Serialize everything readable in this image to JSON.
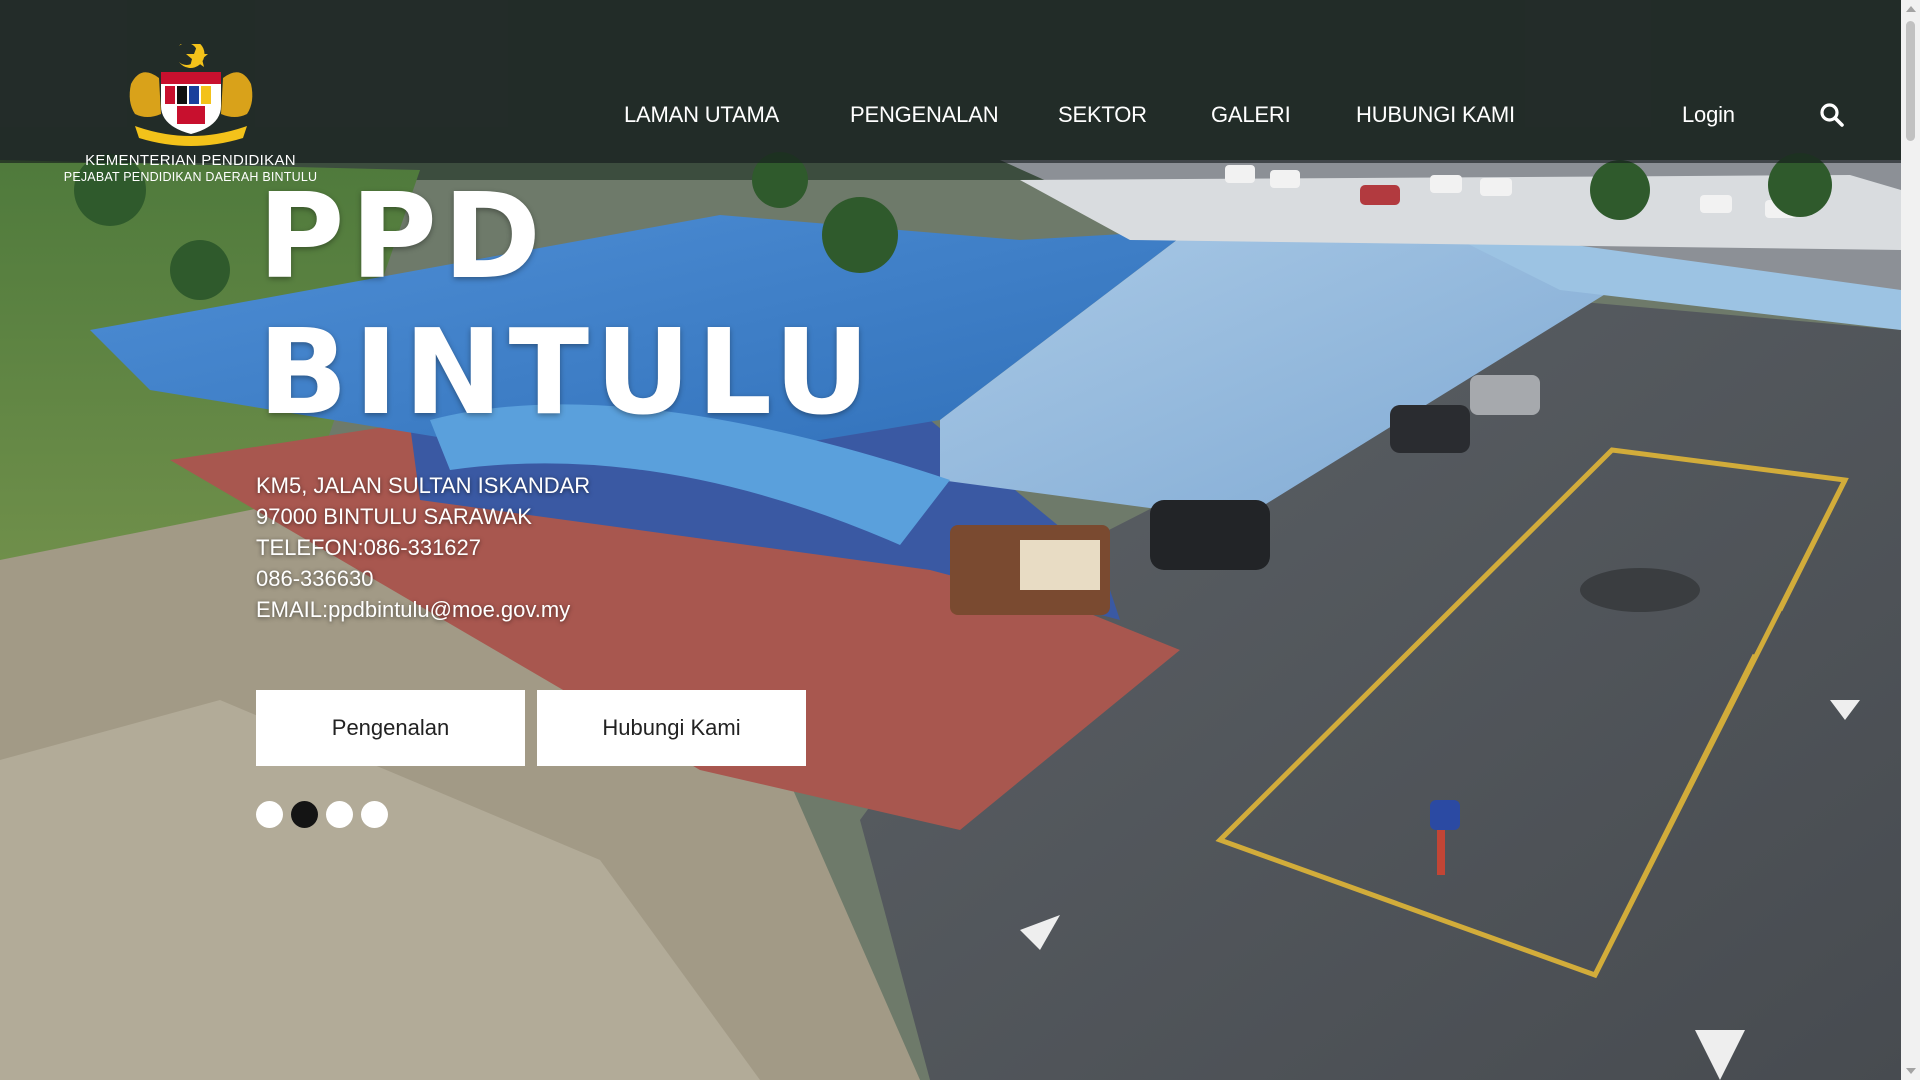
{
  "header": {
    "logo_line1": "KEMENTERIAN PENDIDIKAN",
    "logo_line2": "PEJABAT PENDIDIKAN DAERAH BINTULU"
  },
  "nav": {
    "items": [
      {
        "label": "LAMAN UTAMA"
      },
      {
        "label": "PENGENALAN"
      },
      {
        "label": "SEKTOR"
      },
      {
        "label": "GALERI"
      },
      {
        "label": "HUBUNGI KAMI"
      }
    ],
    "login_label": "Login",
    "search_icon": "search-icon"
  },
  "hero": {
    "title_line1": "PPD",
    "title_line2": "BINTULU",
    "address_lines": [
      "KM5, JALAN SULTAN ISKANDAR",
      "97000 BINTULU SARAWAK",
      "TELEFON:086-331627",
      "086-336630",
      "EMAIL:ppdbintulu@moe.gov.my"
    ],
    "buttons": [
      {
        "label": "Pengenalan"
      },
      {
        "label": "Hubungi Kami"
      }
    ],
    "slides": {
      "count": 4,
      "active_index": 1
    }
  }
}
